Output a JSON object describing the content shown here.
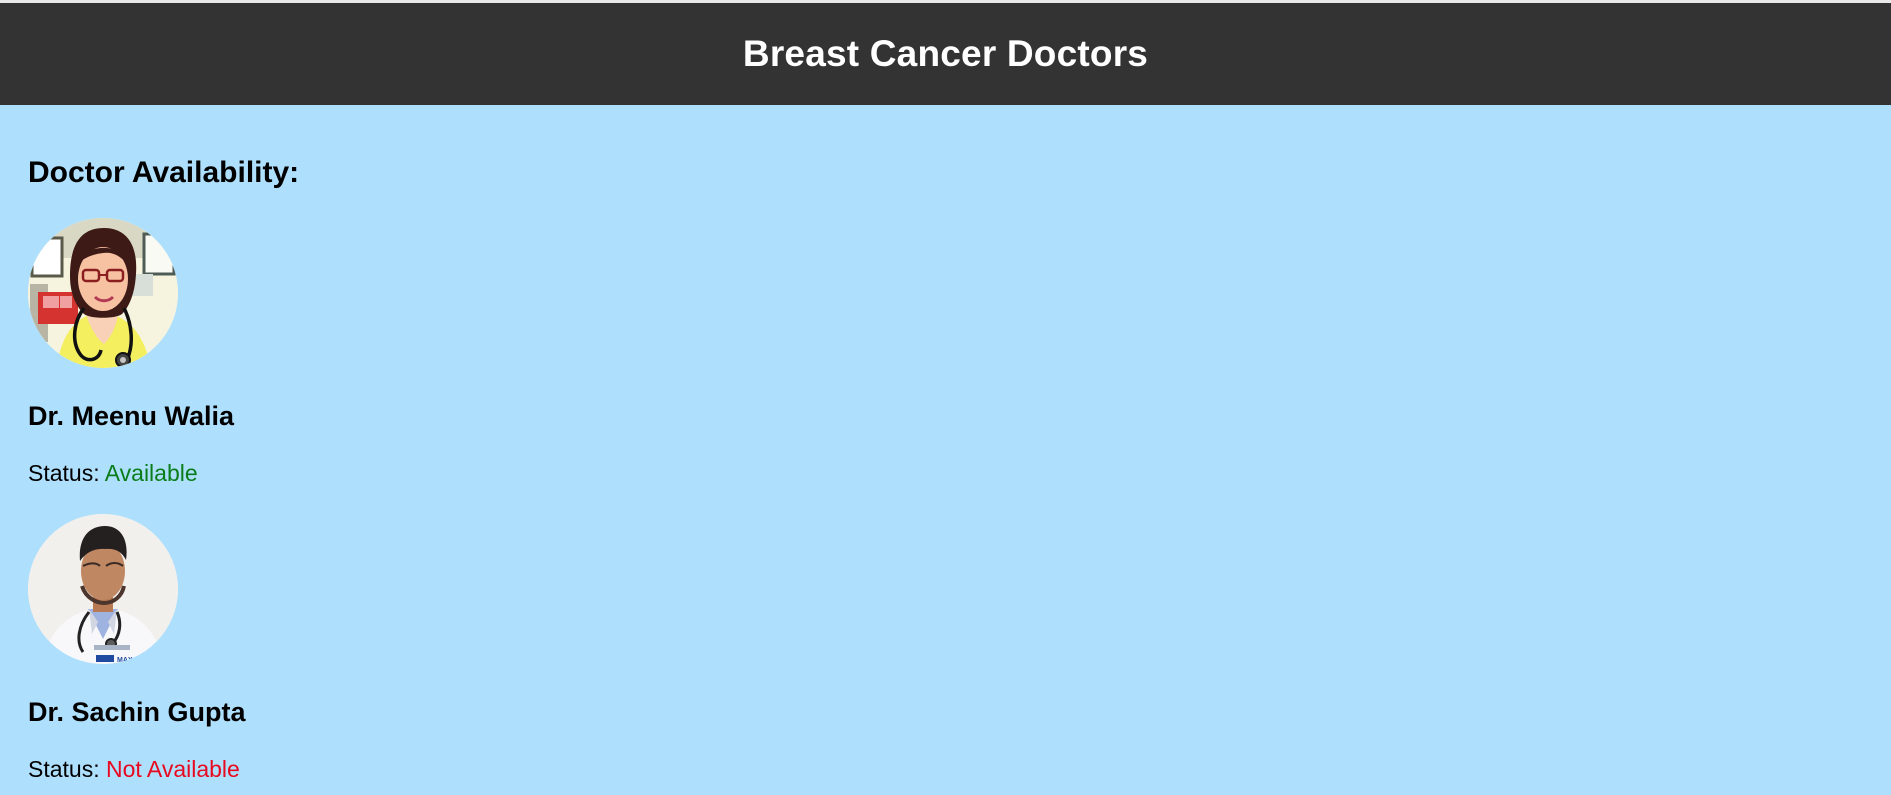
{
  "header": {
    "title": "Breast Cancer Doctors"
  },
  "main": {
    "section_title": "Doctor Availability:",
    "doctors": [
      {
        "name": "Dr. Meenu Walia",
        "status_label": "Status:",
        "status_value": "Available",
        "status_color": "#0a7d1a",
        "avatar_icon": "doctor-photo-female"
      },
      {
        "name": "Dr. Sachin Gupta",
        "status_label": "Status:",
        "status_value": "Not Available",
        "status_color": "#e8081f",
        "avatar_icon": "doctor-photo-male",
        "badge_text": "MAX"
      }
    ]
  },
  "colors": {
    "header_bg": "#333333",
    "page_bg": "#aee0fd",
    "header_text": "#ffffff"
  }
}
